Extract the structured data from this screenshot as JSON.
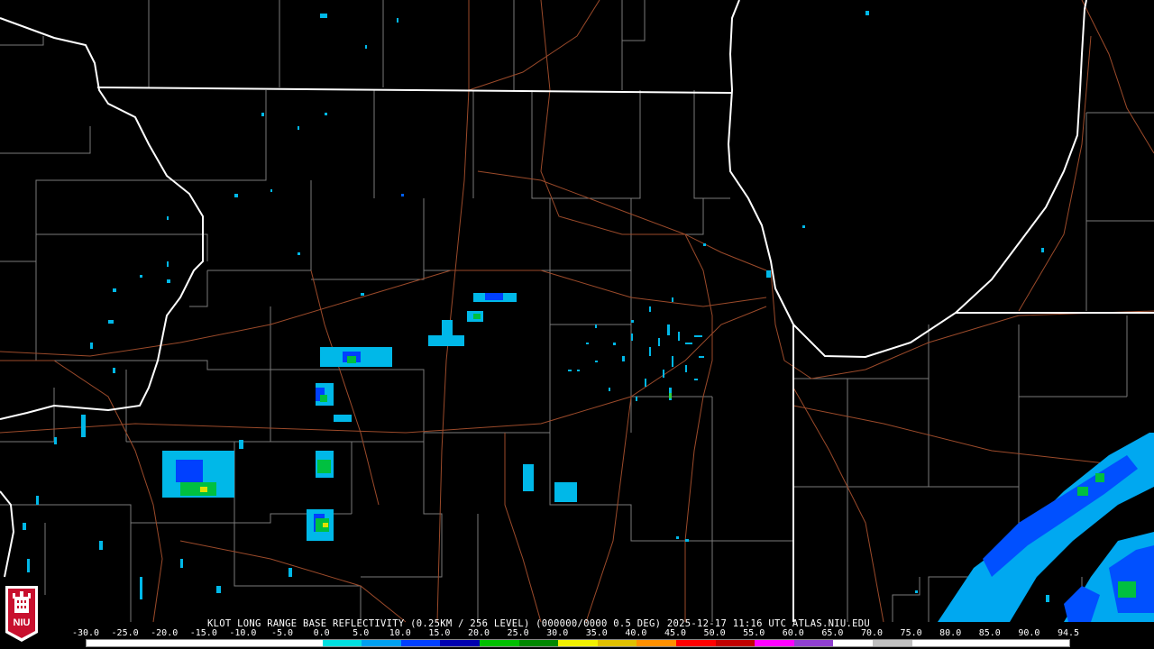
{
  "product": {
    "caption": "KLOT LONG RANGE BASE REFLECTIVITY (0.25KM / 256 LEVEL) (000000/0000 0.5 DEG) 2025-12-17 11:16 UTC  ATLAS.NIU.EDU"
  },
  "logo": {
    "text": "NIU"
  },
  "scale": {
    "labels": [
      "-30.0",
      "-25.0",
      "-20.0",
      "-15.0",
      "-10.0",
      "-5.0",
      "0.0",
      "5.0",
      "10.0",
      "15.0",
      "20.0",
      "25.0",
      "30.0",
      "35.0",
      "40.0",
      "45.0",
      "50.0",
      "55.0",
      "60.0",
      "65.0",
      "70.0",
      "75.0",
      "80.0",
      "85.0",
      "90.0",
      "94.5"
    ],
    "colors": [
      "#ffffff",
      "#ffffff",
      "#ffffff",
      "#ffffff",
      "#ffffff",
      "#ffffff",
      "#00e0e0",
      "#00a0f0",
      "#0040ff",
      "#0000b0",
      "#00c000",
      "#008800",
      "#f0f000",
      "#e0c000",
      "#ff9000",
      "#ff0000",
      "#c00000",
      "#ff00ff",
      "#9040d0",
      "#ffffff",
      "#c0c0c0",
      "#ffffff",
      "#ffffff",
      "#ffffff",
      "#ffffff"
    ]
  },
  "colors": {
    "background": "#000000",
    "state_border": "#ffffff",
    "county_border": "#808080",
    "highway": "#a0522d"
  }
}
